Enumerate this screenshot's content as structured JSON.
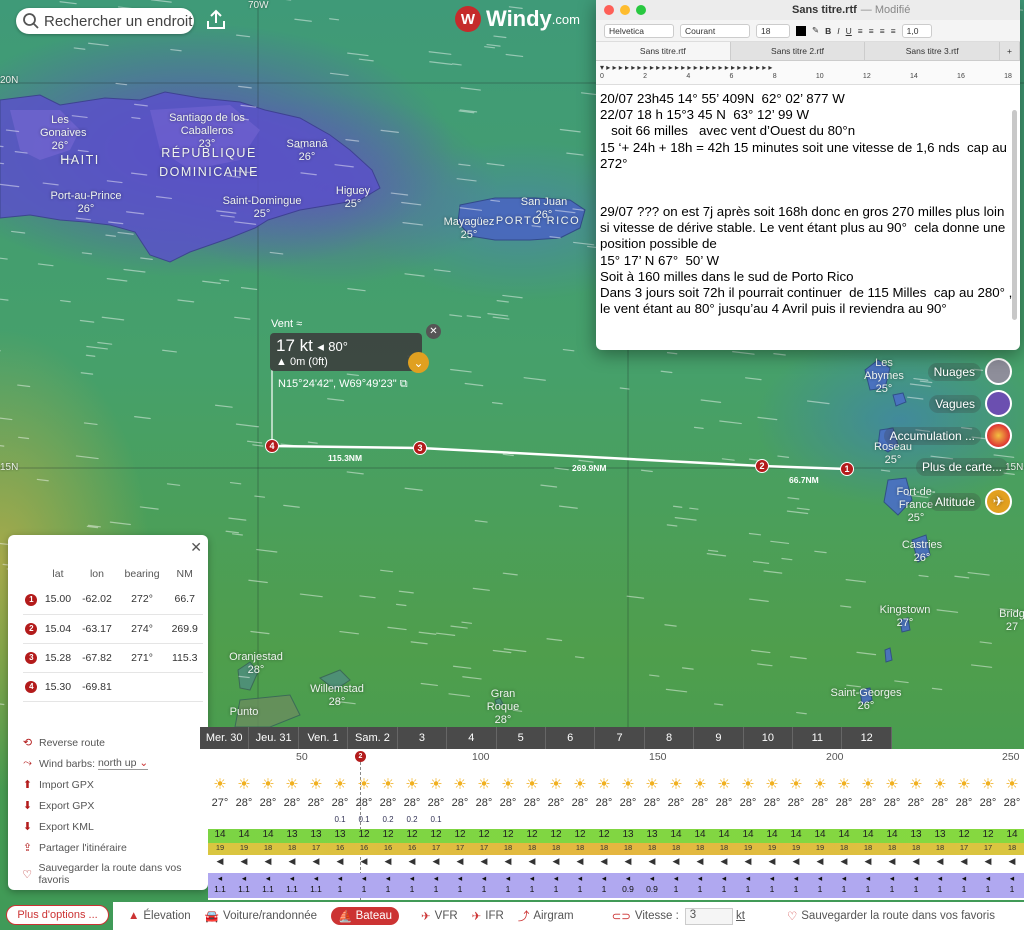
{
  "map": {
    "search_placeholder": "Rechercher un endroit",
    "logo": "Windy",
    "logo_suffix": ".com",
    "grid_labels": [
      "70W",
      "20N",
      "15N",
      "15N"
    ],
    "places": [
      {
        "name": "Les Gonaives",
        "temp": "26°"
      },
      {
        "name": "HAITI",
        "temp": ""
      },
      {
        "name": "Santiago de los Caballeros",
        "temp": "23°"
      },
      {
        "name": "RÉPUBLIQUE DOMINICAINE",
        "temp": ""
      },
      {
        "name": "Samaná",
        "temp": "26°"
      },
      {
        "name": "Port-au-Prince",
        "temp": "26°"
      },
      {
        "name": "Saint-Domingue",
        "temp": "25°"
      },
      {
        "name": "Higuey",
        "temp": "25°"
      },
      {
        "name": "San Juan",
        "temp": "26°"
      },
      {
        "name": "Mayagüez",
        "temp": "25°"
      },
      {
        "name": "PORTO RICO",
        "temp": ""
      },
      {
        "name": "Les Abymes",
        "temp": "25°"
      },
      {
        "name": "Roseau",
        "temp": "25°"
      },
      {
        "name": "Fort-de-France",
        "temp": "25°"
      },
      {
        "name": "Castries",
        "temp": "26°"
      },
      {
        "name": "Kingstown",
        "temp": "27°"
      },
      {
        "name": "Bridg",
        "temp": "27"
      },
      {
        "name": "Saint-Georges",
        "temp": "26°"
      },
      {
        "name": "Oranjestad",
        "temp": "28°"
      },
      {
        "name": "Willemstad",
        "temp": "28°"
      },
      {
        "name": "Punto",
        "temp": ""
      },
      {
        "name": "Gran Roque",
        "temp": "28°"
      }
    ]
  },
  "popup": {
    "title": "Vent",
    "speed": "17 kt",
    "direction": "80°",
    "altitude": "0m (0ft)",
    "coords": "N15°24'42\", W69°49'23\""
  },
  "route": {
    "segments": [
      "115.3NM",
      "269.9NM",
      "66.7NM"
    ],
    "waypoints": [
      "1",
      "2",
      "3",
      "4"
    ],
    "headers": [
      "lat",
      "lon",
      "bearing",
      "NM"
    ],
    "rows": [
      {
        "n": "1",
        "lat": "15.00",
        "lon": "-62.02",
        "bearing": "272°",
        "nm": "66.7"
      },
      {
        "n": "2",
        "lat": "15.04",
        "lon": "-63.17",
        "bearing": "274°",
        "nm": "269.9"
      },
      {
        "n": "3",
        "lat": "15.28",
        "lon": "-67.82",
        "bearing": "271°",
        "nm": "115.3"
      },
      {
        "n": "4",
        "lat": "15.30",
        "lon": "-69.81",
        "bearing": "",
        "nm": ""
      }
    ],
    "actions": {
      "reverse": "Reverse route",
      "wind_barbs": "Wind barbs:",
      "wind_barbs_value": "north up",
      "import": "Import GPX",
      "export_gpx": "Export GPX",
      "export_kml": "Export KML",
      "share": "Partager l'itinéraire",
      "save": "Sauvegarder la route dans vos favoris"
    },
    "more_options": "Plus d'options ..."
  },
  "layers": {
    "clouds": "Nuages",
    "waves": "Vagues",
    "accum": "Accumulation ...",
    "more": "Plus de carte...",
    "altitude": "Altitude"
  },
  "editor": {
    "title": "Sans titre.rtf",
    "modified": "— Modifié",
    "font": "Helvetica",
    "style": "Courant",
    "size": "18",
    "spacing": "1,0",
    "tabs": [
      "Sans titre.rtf",
      "Sans titre 2.rtf",
      "Sans titre 3.rtf"
    ],
    "ruler": [
      "0",
      "2",
      "4",
      "6",
      "8",
      "10",
      "12",
      "14",
      "16",
      "18"
    ],
    "lines": [
      "20/07 23h45 14° 55’ 409N  62° 02’ 877 W",
      "22/07 18 h 15°3 45 N  63° 12’ 99 W",
      "   soit 66 milles   avec vent d’Ouest du 80°n",
      "15 ‘+ 24h + 18h = 42h 15 minutes soit une vitesse de 1,6 nds  cap au 272°",
      "",
      "",
      "29/07 ??? on est 7j après soit 168h donc en gros 270 milles plus loin si vitesse de dérive stable. Le vent étant plus au 90°  cela donne une position possible de",
      "15° 17’ N 67°  50’ W",
      "Soit à 160 milles dans le sud de Porto Rico",
      "Dans 3 jours soit 72h il pourrait continuer  de 115 Milles  cap au 280° , le vent étant au 80° jusqu’au 4 Avril puis il reviendra au 90°"
    ]
  },
  "forecast": {
    "days": [
      "Mer. 30",
      "Jeu. 31",
      "Ven. 1",
      "Sam. 2",
      "3",
      "4",
      "5",
      "6",
      "7",
      "8",
      "9",
      "10",
      "11",
      "12"
    ],
    "distance_ticks": [
      "50",
      "100",
      "150",
      "200",
      "250"
    ],
    "temps": [
      "27°",
      "28°",
      "28°",
      "28°",
      "28°",
      "28°",
      "28°",
      "28°",
      "28°",
      "28°",
      "28°",
      "28°",
      "28°",
      "28°",
      "28°",
      "28°",
      "28°",
      "28°",
      "28°",
      "28°",
      "28°",
      "28°",
      "28°",
      "28°",
      "28°",
      "28°",
      "28°",
      "28°",
      "28°",
      "28°",
      "28°",
      "28°",
      "28°",
      "28°"
    ],
    "precip": [
      "",
      "",
      "",
      "",
      "",
      "0.1",
      "0.1",
      "0.2",
      "0.2",
      "0.1",
      "",
      "",
      "",
      "",
      "",
      "",
      "",
      "",
      "",
      "",
      "",
      "",
      "",
      "",
      "",
      "",
      "",
      "",
      "",
      "",
      "",
      "",
      "",
      ""
    ],
    "wind": [
      "14",
      "14",
      "14",
      "13",
      "13",
      "13",
      "12",
      "12",
      "12",
      "12",
      "12",
      "12",
      "12",
      "12",
      "12",
      "12",
      "12",
      "13",
      "13",
      "14",
      "14",
      "14",
      "14",
      "14",
      "14",
      "14",
      "14",
      "14",
      "14",
      "13",
      "13",
      "12",
      "12",
      "14"
    ],
    "gusts": [
      "19",
      "19",
      "18",
      "18",
      "17",
      "16",
      "16",
      "16",
      "16",
      "17",
      "17",
      "17",
      "18",
      "18",
      "18",
      "18",
      "18",
      "18",
      "18",
      "18",
      "18",
      "18",
      "19",
      "19",
      "19",
      "19",
      "18",
      "18",
      "18",
      "18",
      "18",
      "17",
      "17",
      "18"
    ],
    "waves": [
      "1.1",
      "1.1",
      "1.1",
      "1.1",
      "1.1",
      "1",
      "1",
      "1",
      "1",
      "1",
      "1",
      "1",
      "1",
      "1",
      "1",
      "1",
      "1",
      "0.9",
      "0.9",
      "1",
      "1",
      "1",
      "1",
      "1",
      "1",
      "1",
      "1",
      "1",
      "1",
      "1",
      "1",
      "1",
      "1",
      "1"
    ],
    "waypoint_marker": "2"
  },
  "bottom": {
    "elevation": "Élevation",
    "car": "Voiture/randonnée",
    "boat": "Bateau",
    "vfr": "VFR",
    "ifr": "IFR",
    "airgram": "Airgram",
    "speed_label": "Vitesse :",
    "speed_value": "3",
    "speed_unit": "kt",
    "save": "Sauvegarder la route dans vos favoris"
  },
  "colors": {
    "accent": "#c33333",
    "route": "#b31b1b"
  }
}
